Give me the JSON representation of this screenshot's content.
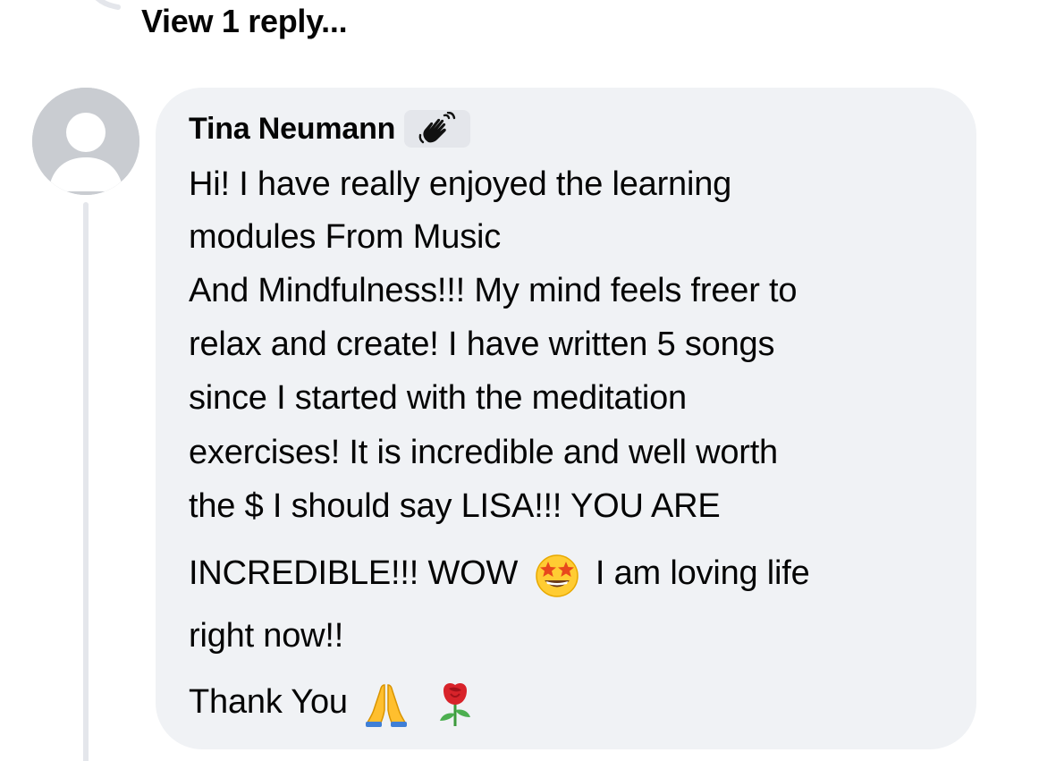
{
  "thread": {
    "view_replies_label": "View 1 reply..."
  },
  "comment": {
    "author": "Tina Neumann",
    "badge_icon": "waving-hand-icon",
    "lines": [
      "Hi! I have really enjoyed the learning",
      "modules From Music",
      "And Mindfulness!!! My mind feels freer to",
      "relax and create! I have written 5 songs",
      "since I started with the meditation",
      "exercises! It is incredible and well worth",
      "the $ I should say LISA!!! YOU ARE"
    ],
    "line8_before_emoji": "INCREDIBLE!!! WOW",
    "line8_emoji": "star-struck-emoji",
    "line8_after_emoji": "I am loving life",
    "line9": "right now!!",
    "line10_text": "Thank You",
    "line10_emojis": [
      "folded-hands-emoji",
      "rose-emoji"
    ]
  },
  "colors": {
    "bubble_bg": "#f0f2f5",
    "text": "#050505",
    "avatar_bg": "#c9ccd1",
    "thread_line": "#e4e6eb"
  }
}
